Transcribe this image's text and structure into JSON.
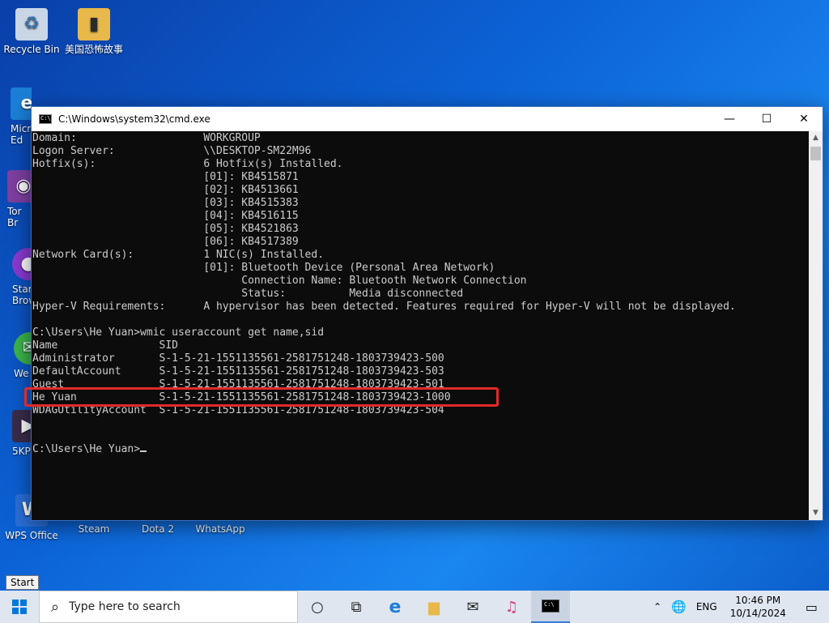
{
  "desktop": {
    "icons": [
      {
        "label": "Recycle Bin"
      },
      {
        "label": "美国恐怖故事"
      },
      {
        "label": "Micr Ed"
      },
      {
        "label": "Tor Br"
      },
      {
        "label": "Star Brow"
      },
      {
        "label": "We"
      },
      {
        "label": "5KPI"
      },
      {
        "label": "WPS Office"
      },
      {
        "label": "Steam"
      },
      {
        "label": "Dota 2"
      },
      {
        "label": "WhatsApp"
      }
    ]
  },
  "cmd": {
    "title": "C:\\Windows\\system32\\cmd.exe",
    "lines": [
      "Domain:                    WORKGROUP",
      "Logon Server:              \\\\DESKTOP-SM22M96",
      "Hotfix(s):                 6 Hotfix(s) Installed.",
      "                           [01]: KB4515871",
      "                           [02]: KB4513661",
      "                           [03]: KB4515383",
      "                           [04]: KB4516115",
      "                           [05]: KB4521863",
      "                           [06]: KB4517389",
      "Network Card(s):           1 NIC(s) Installed.",
      "                           [01]: Bluetooth Device (Personal Area Network)",
      "                                 Connection Name: Bluetooth Network Connection",
      "                                 Status:          Media disconnected",
      "Hyper-V Requirements:      A hypervisor has been detected. Features required for Hyper-V will not be displayed.",
      "",
      "C:\\Users\\He Yuan>wmic useraccount get name,sid",
      "Name                SID",
      "Administrator       S-1-5-21-1551135561-2581751248-1803739423-500",
      "DefaultAccount      S-1-5-21-1551135561-2581751248-1803739423-503",
      "Guest               S-1-5-21-1551135561-2581751248-1803739423-501",
      "He Yuan             S-1-5-21-1551135561-2581751248-1803739423-1000",
      "WDAGUtilityAccount  S-1-5-21-1551135561-2581751248-1803739423-504",
      "",
      ""
    ],
    "prompt": "C:\\Users\\He Yuan>"
  },
  "tooltip": "Start",
  "taskbar": {
    "search_placeholder": "Type here to search",
    "language": "ENG",
    "time": "10:46 PM",
    "date": "10/14/2024"
  },
  "colors": {
    "highlight": "#e02a2a"
  }
}
